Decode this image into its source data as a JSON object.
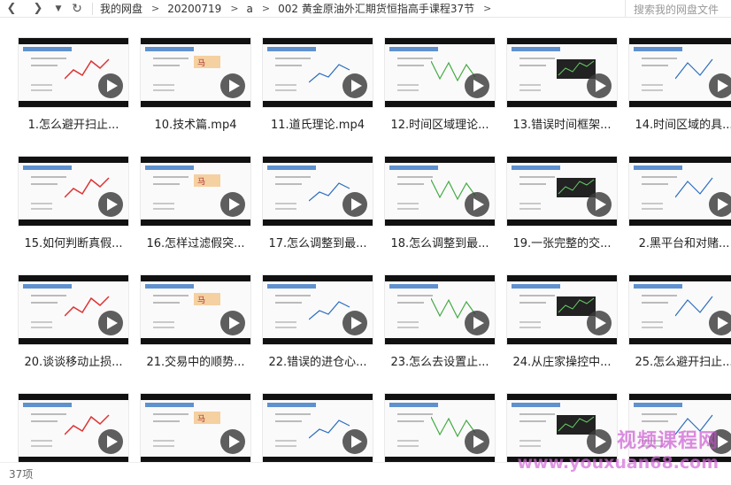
{
  "toolbar": {
    "back_icon": "chevron-left-icon",
    "forward_icon": "chevron-right-icon",
    "history_icon": "caret-down-icon",
    "refresh_icon": "refresh-icon",
    "breadcrumbs": [
      "我的网盘",
      "20200719",
      "a",
      "002 黄金原油外汇期货恒指高手课程37节"
    ],
    "search_placeholder": "搜索我的网盘文件"
  },
  "files": [
    {
      "name": "1.怎么避开扫止..."
    },
    {
      "name": "10.技术篇.mp4"
    },
    {
      "name": "11.道氏理论.mp4"
    },
    {
      "name": "12.时间区域理论..."
    },
    {
      "name": "13.错误时间框架..."
    },
    {
      "name": "14.时间区域的具..."
    },
    {
      "name": "15.如何判断真假..."
    },
    {
      "name": "16.怎样过滤假突..."
    },
    {
      "name": "17.怎么调整到最..."
    },
    {
      "name": "18.怎么调整到最..."
    },
    {
      "name": "19.一张完整的交..."
    },
    {
      "name": "2.黑平台和对赌..."
    },
    {
      "name": "20.谈谈移动止损..."
    },
    {
      "name": "21.交易中的顺势..."
    },
    {
      "name": "22.错误的进仓心..."
    },
    {
      "name": "23.怎么去设置止..."
    },
    {
      "name": "24.从庄家操控中..."
    },
    {
      "name": "25.怎么避开扫止..."
    },
    {
      "name": ""
    },
    {
      "name": ""
    },
    {
      "name": ""
    },
    {
      "name": ""
    },
    {
      "name": ""
    },
    {
      "name": ""
    }
  ],
  "status": {
    "count": "37项"
  },
  "watermark": {
    "line1": "视频课程网",
    "line2": "www.youxuan68.com"
  },
  "colors": {
    "accent": "#2b6dbf",
    "play_overlay": "#3c3c3c",
    "watermark": "#c94fd0"
  }
}
